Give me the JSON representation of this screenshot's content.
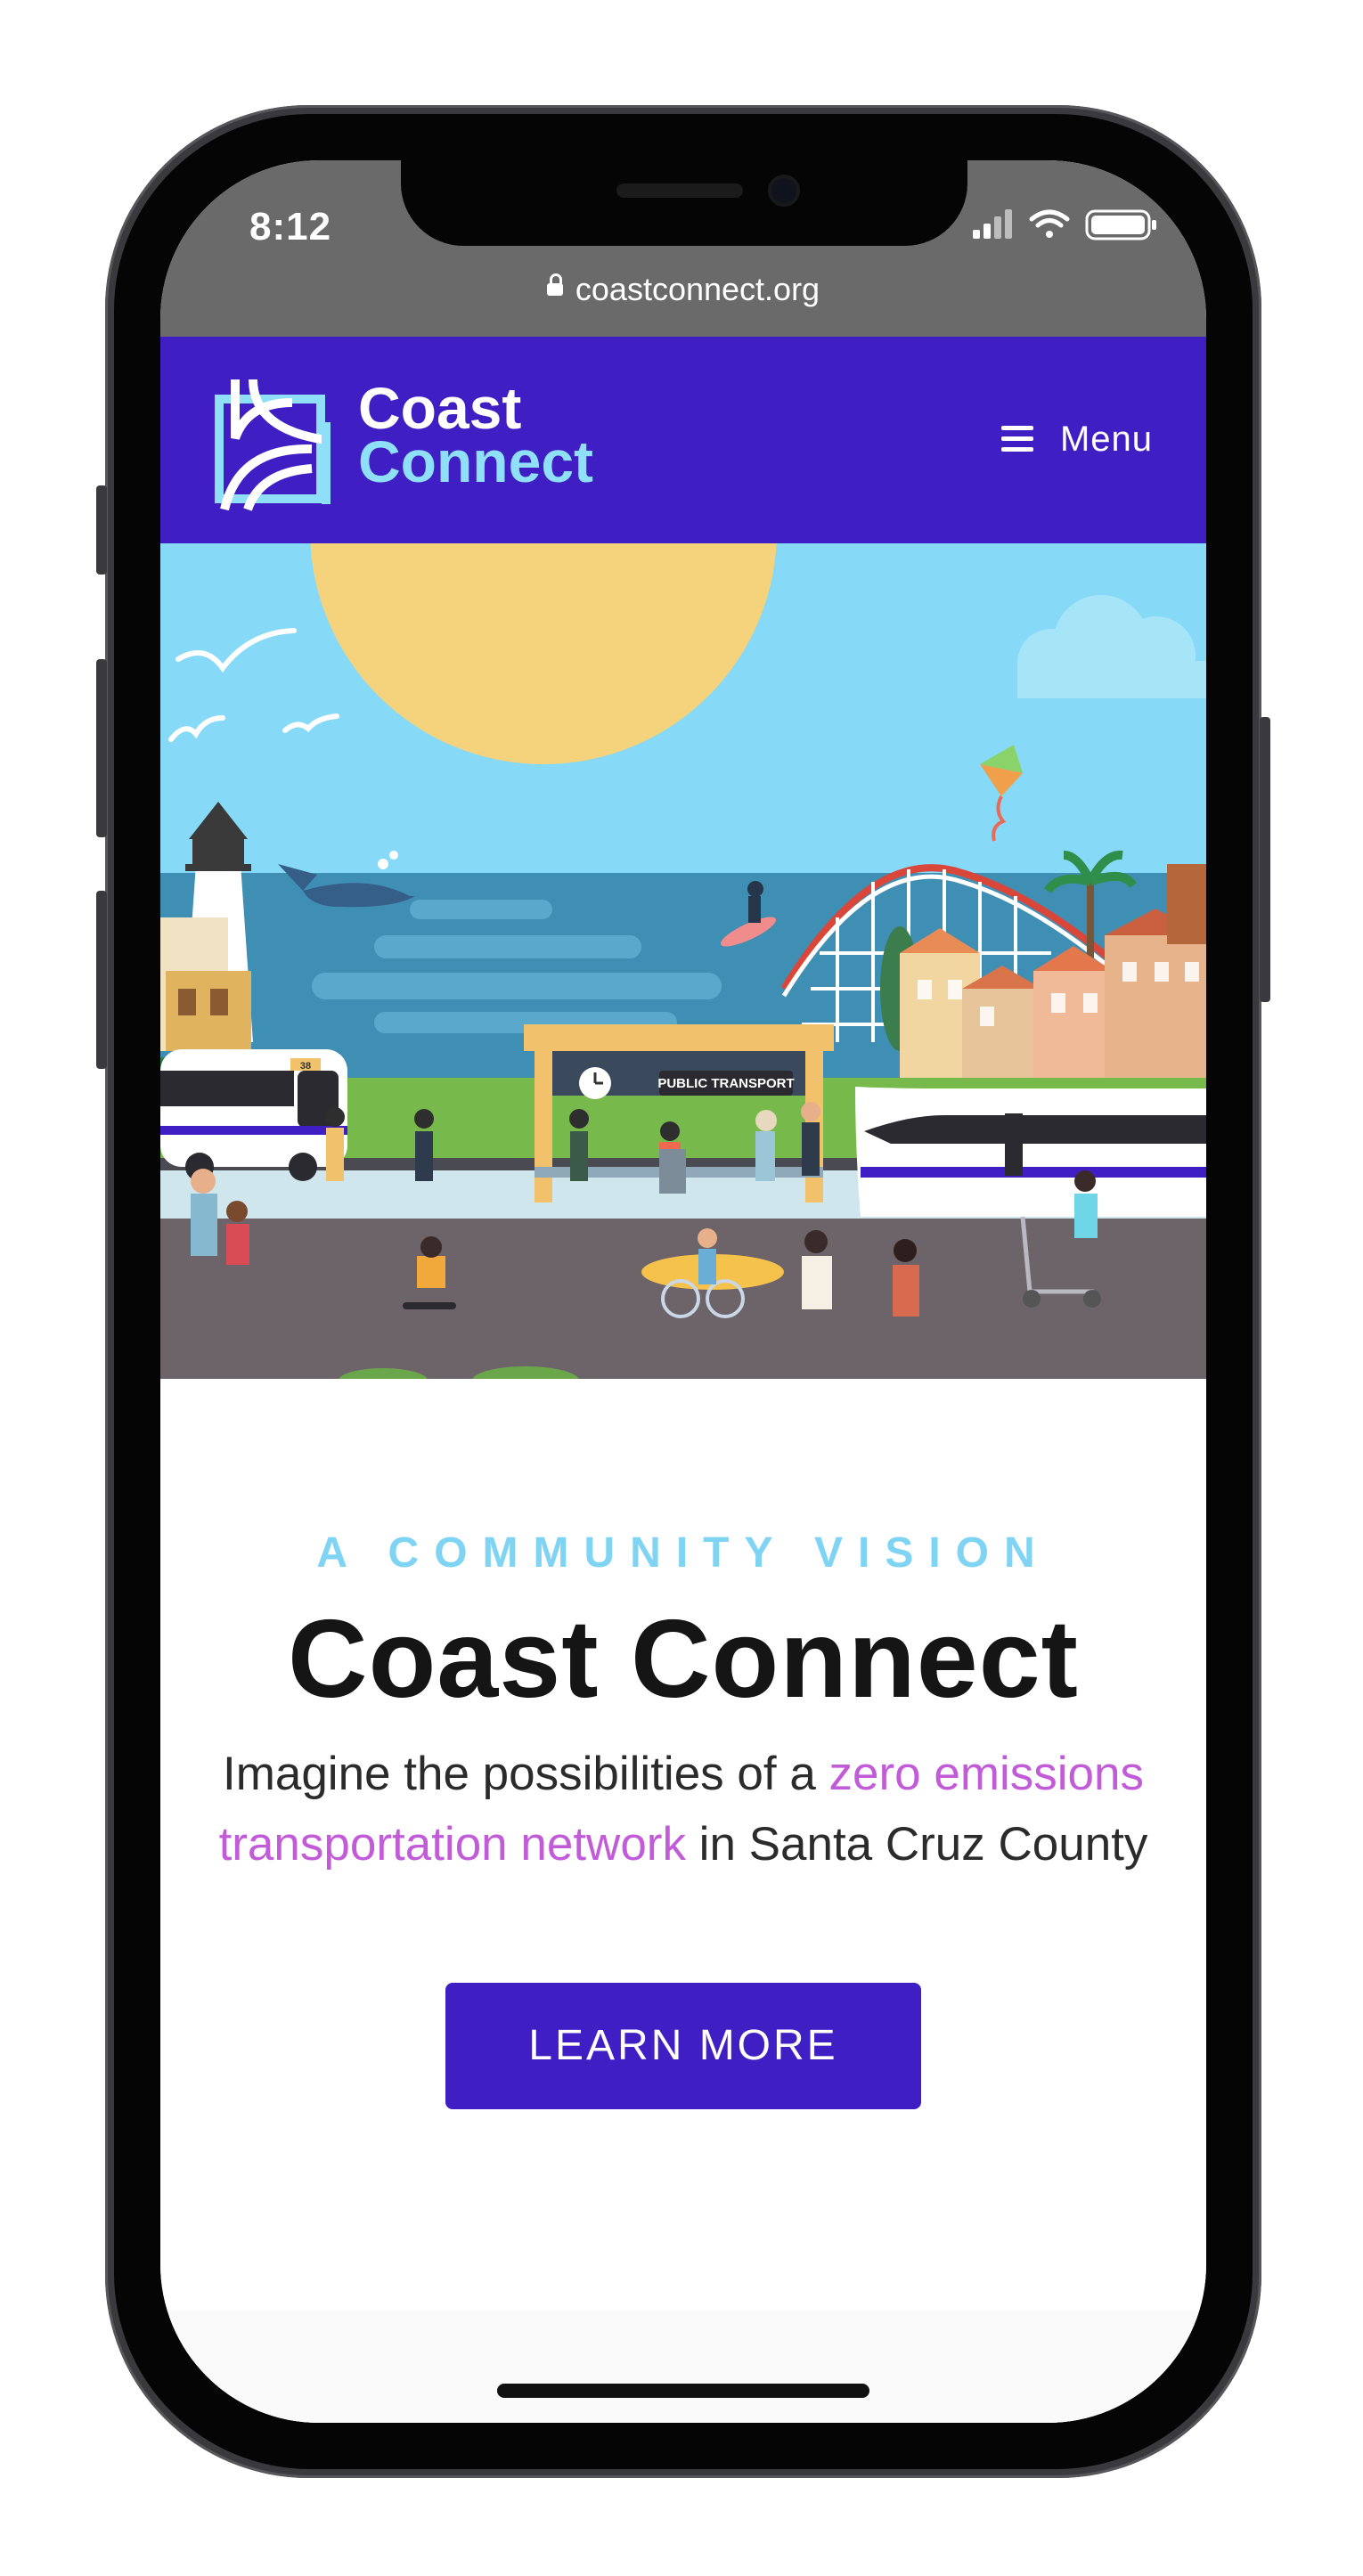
{
  "status_bar": {
    "time": "8:12",
    "url": "coastconnect.org",
    "icons": [
      "signal-icon",
      "wifi-icon",
      "battery-icon"
    ]
  },
  "header": {
    "logo_line1": "Coast",
    "logo_line2": "Connect",
    "menu_label": "Menu"
  },
  "hero": {
    "station_sign": "PUBLIC TRANSPORT",
    "bus_number": "38"
  },
  "main": {
    "eyebrow": "A COMMUNITY VISION",
    "title": "Coast Connect",
    "lead_before": "Imagine the possibilities of a ",
    "lead_highlight": "zero emissions transportation network",
    "lead_after": " in Santa Cruz County",
    "cta_label": "LEARN MORE"
  },
  "colors": {
    "brand": "#3f1fc3",
    "accent_light": "#8fdff8",
    "highlight": "#c25bd8",
    "status_bar": "#6a6a6a"
  }
}
